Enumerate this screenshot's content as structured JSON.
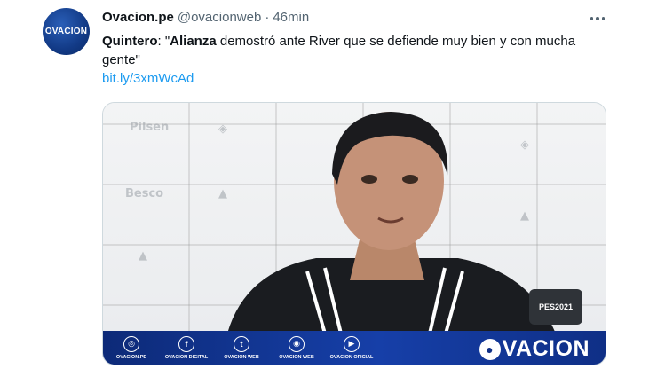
{
  "tweet": {
    "display_name": "Ovacion.pe",
    "handle": "@ovacionweb",
    "separator": "·",
    "time": "46min",
    "text_prefix": "Quintero",
    "text_after_prefix": ": \"",
    "text_bold": "Alianza",
    "text_rest": " demostró ante River que se defiende muy bien y con mucha gente\"",
    "link": "bit.ly/3xmWcAd"
  },
  "avatar": {
    "logo_text": "OVACION"
  },
  "media": {
    "banner": {
      "social": [
        {
          "icon": "web-icon",
          "glyph": "◎",
          "label": "OVACION.PE"
        },
        {
          "icon": "facebook-icon",
          "glyph": "f",
          "label": "OVACION DIGITAL"
        },
        {
          "icon": "twitter-icon",
          "glyph": "t",
          "label": "OVACION WEB"
        },
        {
          "icon": "instagram-icon",
          "glyph": "◉",
          "label": "OVACION WEB"
        },
        {
          "icon": "youtube-icon",
          "glyph": "▶",
          "label": "OVACION OFICIAL"
        }
      ],
      "brand_text": "VACION"
    },
    "mic_badge": "PES2021"
  },
  "colors": {
    "link": "#1d9bf0",
    "banner": "#163fa8",
    "secondary_text": "#536471"
  }
}
